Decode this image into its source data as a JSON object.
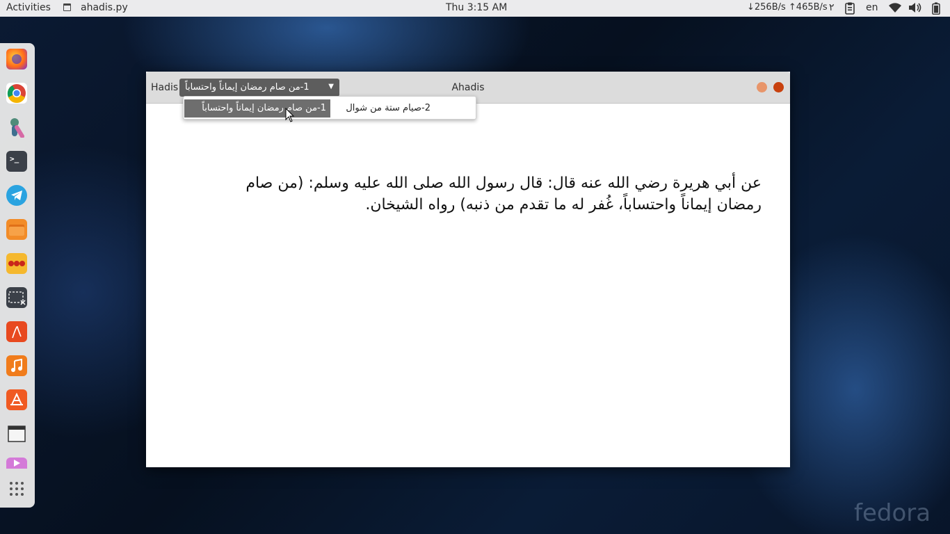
{
  "topbar": {
    "activities": "Activities",
    "app_name": "ahadis.py",
    "clock": "Thu  3:15 AM",
    "net_speed": "↓256B/s ↑465B/s",
    "workspace": "٢",
    "language": "en"
  },
  "dock": {
    "apps": [
      "firefox-icon",
      "chrome-icon",
      "app-r-icon",
      "terminal-icon",
      "telegram-icon",
      "files-icon",
      "dots-app-icon",
      "screenshot-icon",
      "acrobat-icon",
      "music-icon",
      "software-icon",
      "window-icon",
      "video-icon",
      "app-grid-icon"
    ]
  },
  "window": {
    "label": "Hadis",
    "combo_value": "1-من صام رمضان إيماناً واحتساباً",
    "title": "Ahadis",
    "minimize_color": "#e8956a",
    "close_color": "#c8410e",
    "body_text": "عن أبي هريرة رضي الله عنه قال: قال رسول الله صلى الله عليه وسلم: (من صام رمضان إيماناً واحتساباً، غُفر له ما تقدم من ذنبه) رواه الشيخان."
  },
  "popup": {
    "items": [
      {
        "label": "1-من صام رمضان إيماناً واحتساباً"
      },
      {
        "label": "2-صيام ستة من شوال"
      }
    ]
  },
  "wallpaper": {
    "brand": "fedora"
  }
}
